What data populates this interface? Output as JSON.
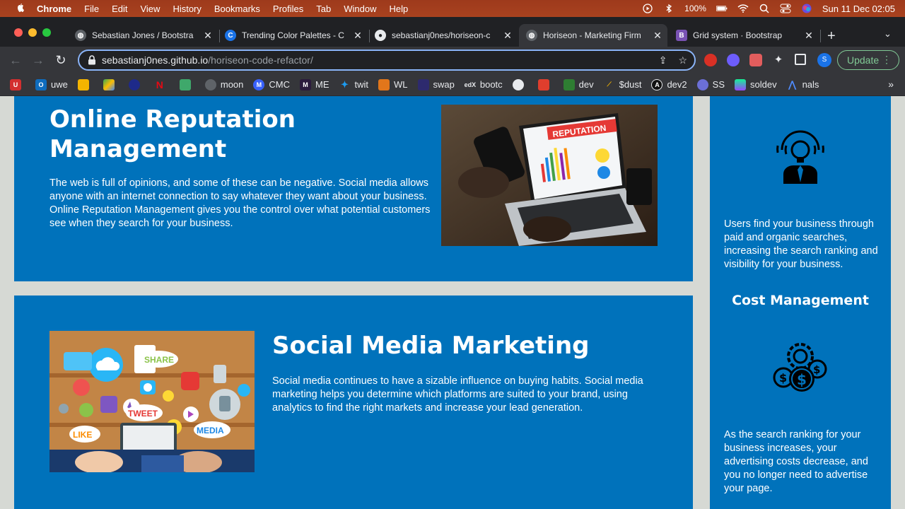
{
  "menubar": {
    "app": "Chrome",
    "items": [
      "File",
      "Edit",
      "View",
      "History",
      "Bookmarks",
      "Profiles",
      "Tab",
      "Window",
      "Help"
    ],
    "battery": "100%",
    "datetime": "Sun 11 Dec  02:05"
  },
  "tabs": [
    {
      "title": "Sebastian Jones / Bootstra",
      "active": false
    },
    {
      "title": "Trending Color Palettes - C",
      "active": false
    },
    {
      "title": "sebastianj0nes/horiseon-c",
      "active": false
    },
    {
      "title": "Horiseon - Marketing Firm",
      "active": true
    },
    {
      "title": "Grid system · Bootstrap",
      "active": false
    }
  ],
  "address": {
    "host": "sebastianj0nes.github.io",
    "path": "/horiseon-code-refactor/"
  },
  "toolbar": {
    "profile_initial": "S",
    "update_label": "Update"
  },
  "bookmarks": [
    "uwe",
    "",
    "",
    "",
    "",
    "",
    "moon",
    "CMC",
    "ME",
    "twit",
    "WL",
    "swap",
    "bootc",
    "",
    "",
    "dev",
    "$dust",
    "dev2",
    "SS",
    "soldev",
    "nals"
  ],
  "content": {
    "orm": {
      "title": "Online Reputation Management",
      "body": "The web is full of opinions, and some of these can be negative. Social media allows anyone with an internet connection to say whatever they want about your business. Online Reputation Management gives you the control over what potential customers see when they search for your business.",
      "image_text": "REPUTATION"
    },
    "smm": {
      "title": "Social Media Marketing",
      "body": "Social media continues to have a sizable influence on buying habits. Social media marketing helps you determine which platforms are suited to your brand, using analytics to find the right markets and increase your lead generation.",
      "image_labels": [
        "SHARE",
        "TWEET",
        "LIKE",
        "MEDIA"
      ]
    },
    "sidebar": {
      "lead_body": "Users find your business through paid and organic searches, increasing the search ranking and visibility for your business.",
      "cost_title": "Cost Management",
      "cost_body": "As the search ranking for your business increases, your advertising costs decrease, and you no longer need to advertise your page."
    }
  },
  "colors": {
    "page_bg": "#d6d9d4",
    "card_bg": "#0072bb",
    "menubar": "#a8421f",
    "chrome_dark": "#202124",
    "chrome_toolbar": "#35363a"
  }
}
